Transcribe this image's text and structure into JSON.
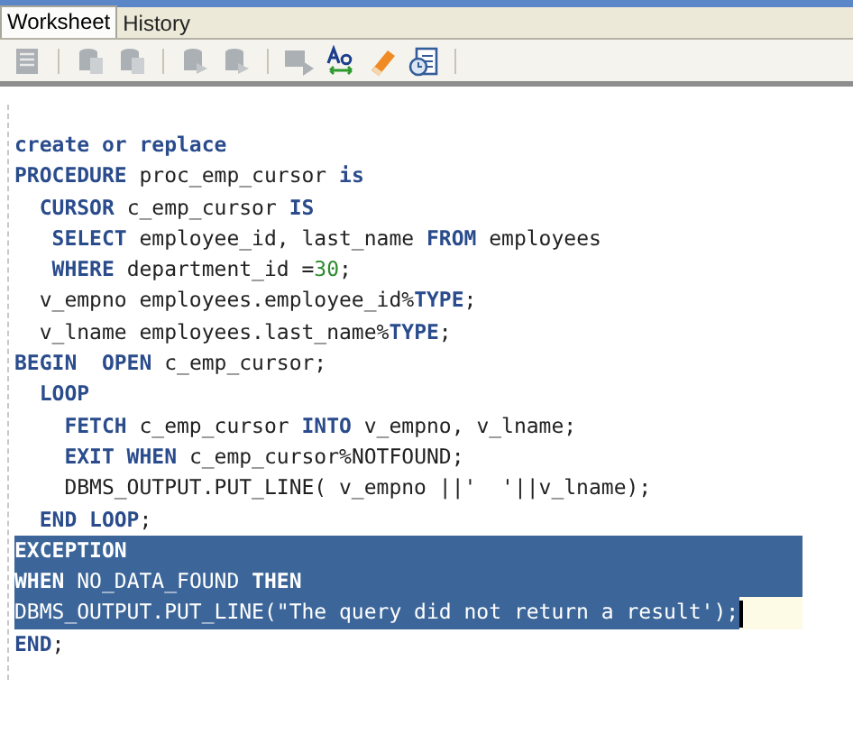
{
  "tabs": [
    {
      "label": "Worksheet",
      "selected": true
    },
    {
      "label": "History",
      "selected": false
    }
  ],
  "toolbar": [
    {
      "kind": "document",
      "disabled": true
    },
    {
      "kind": "sep"
    },
    {
      "kind": "db-doc",
      "disabled": true
    },
    {
      "kind": "db-doc",
      "disabled": true
    },
    {
      "kind": "sep"
    },
    {
      "kind": "db-arrow",
      "disabled": true
    },
    {
      "kind": "db-arrow",
      "disabled": true
    },
    {
      "kind": "sep"
    },
    {
      "kind": "sql",
      "disabled": true
    },
    {
      "kind": "case",
      "disabled": false
    },
    {
      "kind": "eraser",
      "disabled": false
    },
    {
      "kind": "clock",
      "disabled": false
    },
    {
      "kind": "sep"
    }
  ],
  "editor": {
    "lines": [
      {
        "selected": false,
        "current": false,
        "tokens": [
          {
            "kind": "keyword",
            "text": "create or replace"
          }
        ]
      },
      {
        "selected": false,
        "current": false,
        "tokens": [
          {
            "kind": "keyword",
            "text": "PROCEDURE"
          },
          {
            "kind": "plain",
            "text": " proc_emp_cursor "
          },
          {
            "kind": "keyword",
            "text": "is"
          }
        ]
      },
      {
        "selected": false,
        "current": false,
        "tokens": [
          {
            "kind": "keyword",
            "text": "  CURSOR"
          },
          {
            "kind": "plain",
            "text": " c_emp_cursor "
          },
          {
            "kind": "keyword",
            "text": "IS"
          }
        ]
      },
      {
        "selected": false,
        "current": false,
        "tokens": [
          {
            "kind": "keyword",
            "text": "   SELECT"
          },
          {
            "kind": "plain",
            "text": " employee_id, last_name "
          },
          {
            "kind": "keyword",
            "text": "FROM"
          },
          {
            "kind": "plain",
            "text": " employees"
          }
        ]
      },
      {
        "selected": false,
        "current": false,
        "tokens": [
          {
            "kind": "keyword",
            "text": "   WHERE"
          },
          {
            "kind": "plain",
            "text": " department_id ="
          },
          {
            "kind": "number",
            "text": "30"
          },
          {
            "kind": "plain",
            "text": ";"
          }
        ]
      },
      {
        "selected": false,
        "current": false,
        "tokens": [
          {
            "kind": "plain",
            "text": "  v_empno employees.employee_id%"
          },
          {
            "kind": "keyword",
            "text": "TYPE"
          },
          {
            "kind": "plain",
            "text": ";"
          }
        ]
      },
      {
        "selected": false,
        "current": false,
        "tokens": [
          {
            "kind": "plain",
            "text": "  v_lname employees.last_name%"
          },
          {
            "kind": "keyword",
            "text": "TYPE"
          },
          {
            "kind": "plain",
            "text": ";"
          }
        ]
      },
      {
        "selected": false,
        "current": false,
        "tokens": [
          {
            "kind": "keyword",
            "text": "BEGIN  OPEN"
          },
          {
            "kind": "plain",
            "text": " c_emp_cursor;"
          }
        ]
      },
      {
        "selected": false,
        "current": false,
        "tokens": [
          {
            "kind": "keyword",
            "text": "  LOOP"
          }
        ]
      },
      {
        "selected": false,
        "current": false,
        "tokens": [
          {
            "kind": "keyword",
            "text": "    FETCH"
          },
          {
            "kind": "plain",
            "text": " c_emp_cursor "
          },
          {
            "kind": "keyword",
            "text": "INTO"
          },
          {
            "kind": "plain",
            "text": " v_empno, v_lname;"
          }
        ]
      },
      {
        "selected": false,
        "current": false,
        "tokens": [
          {
            "kind": "keyword",
            "text": "    EXIT WHEN"
          },
          {
            "kind": "plain",
            "text": " c_emp_cursor%NOTFOUND;"
          }
        ]
      },
      {
        "selected": false,
        "current": false,
        "tokens": [
          {
            "kind": "plain",
            "text": "    DBMS_OUTPUT.PUT_LINE( v_empno ||'  '||v_lname);"
          }
        ]
      },
      {
        "selected": false,
        "current": false,
        "tokens": [
          {
            "kind": "keyword",
            "text": "  END LOOP"
          },
          {
            "kind": "plain",
            "text": ";"
          }
        ]
      },
      {
        "selected": true,
        "current": false,
        "tokens": [
          {
            "kind": "keyword",
            "text": "EXCEPTION"
          }
        ]
      },
      {
        "selected": true,
        "current": false,
        "tokens": [
          {
            "kind": "keyword",
            "text": "WHEN"
          },
          {
            "kind": "plain",
            "text": " NO_DATA_FOUND "
          },
          {
            "kind": "keyword",
            "text": "THEN"
          }
        ]
      },
      {
        "selected": true,
        "current": true,
        "tokens": [
          {
            "kind": "plain",
            "text": "DBMS_OUTPUT.PUT_LINE(\"The query did not return a result');"
          }
        ]
      },
      {
        "selected": false,
        "current": false,
        "tokens": [
          {
            "kind": "keyword",
            "text": "END"
          },
          {
            "kind": "plain",
            "text": ";"
          }
        ]
      }
    ]
  }
}
